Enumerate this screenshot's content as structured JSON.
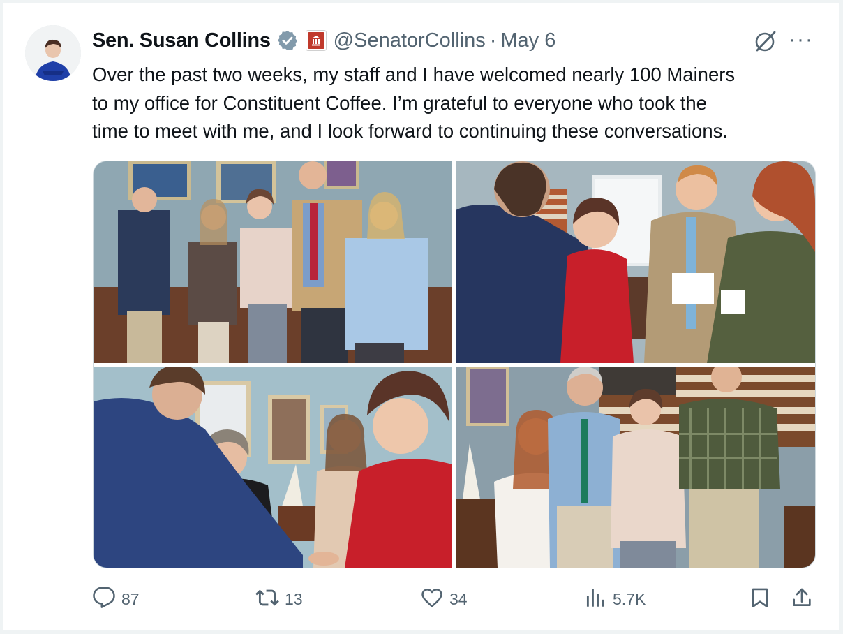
{
  "tweet": {
    "author_name": "Sen. Susan Collins",
    "handle": "@SenatorCollins",
    "separator": "·",
    "date": "May 6",
    "text_lines": [
      "Over the past two weeks, my staff and I have welcomed nearly 100 Mainers",
      "to my office for Constituent Coffee. I’m grateful to everyone who took the",
      "time to meet with me, and I look forward to continuing these conversations."
    ],
    "more_label": "···"
  },
  "metrics": {
    "replies": "87",
    "reposts": "13",
    "likes": "34",
    "views": "5.7K"
  },
  "icons": {
    "verified": "verified-badge-icon",
    "affiliation": "government-building-icon",
    "grok": "grok-icon",
    "reply": "reply-icon",
    "repost": "repost-icon",
    "like": "heart-icon",
    "views": "views-icon",
    "bookmark": "bookmark-icon",
    "share": "share-icon"
  },
  "colors": {
    "text": "#0f1419",
    "secondary": "#536471",
    "verified_badge": "#829aab",
    "affiliation_badge": "#c0392b",
    "border": "#cfd9de"
  }
}
